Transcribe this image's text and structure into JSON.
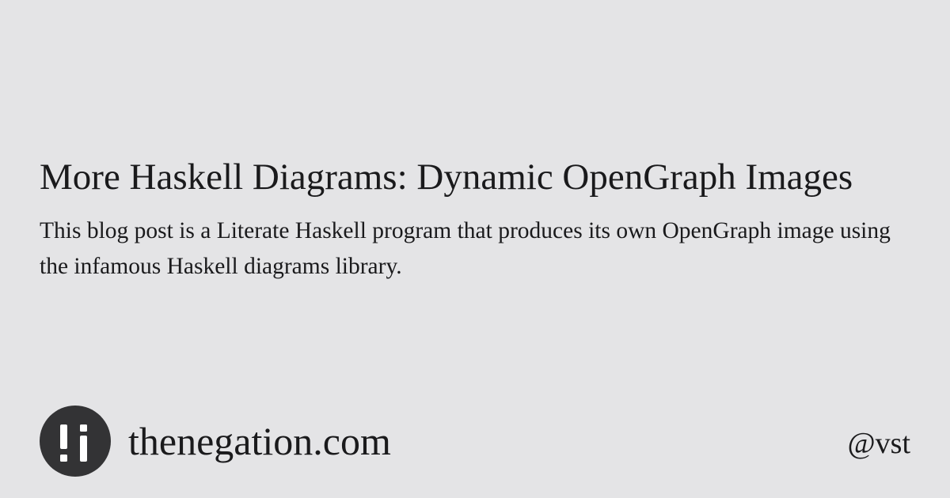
{
  "post": {
    "title": "More Haskell Diagrams: Dynamic OpenGraph Images",
    "description": "This blog post is a Literate Haskell program that produces its own OpenGraph image using the infamous Haskell diagrams library."
  },
  "footer": {
    "logo_icon": "exclamation-i-logo-icon",
    "site_name": "thenegation.com",
    "handle": "@vst"
  },
  "colors": {
    "background": "#e4e4e6",
    "text": "#1a1a1c",
    "logo_circle": "#333335",
    "logo_glyph": "#ffffff"
  }
}
